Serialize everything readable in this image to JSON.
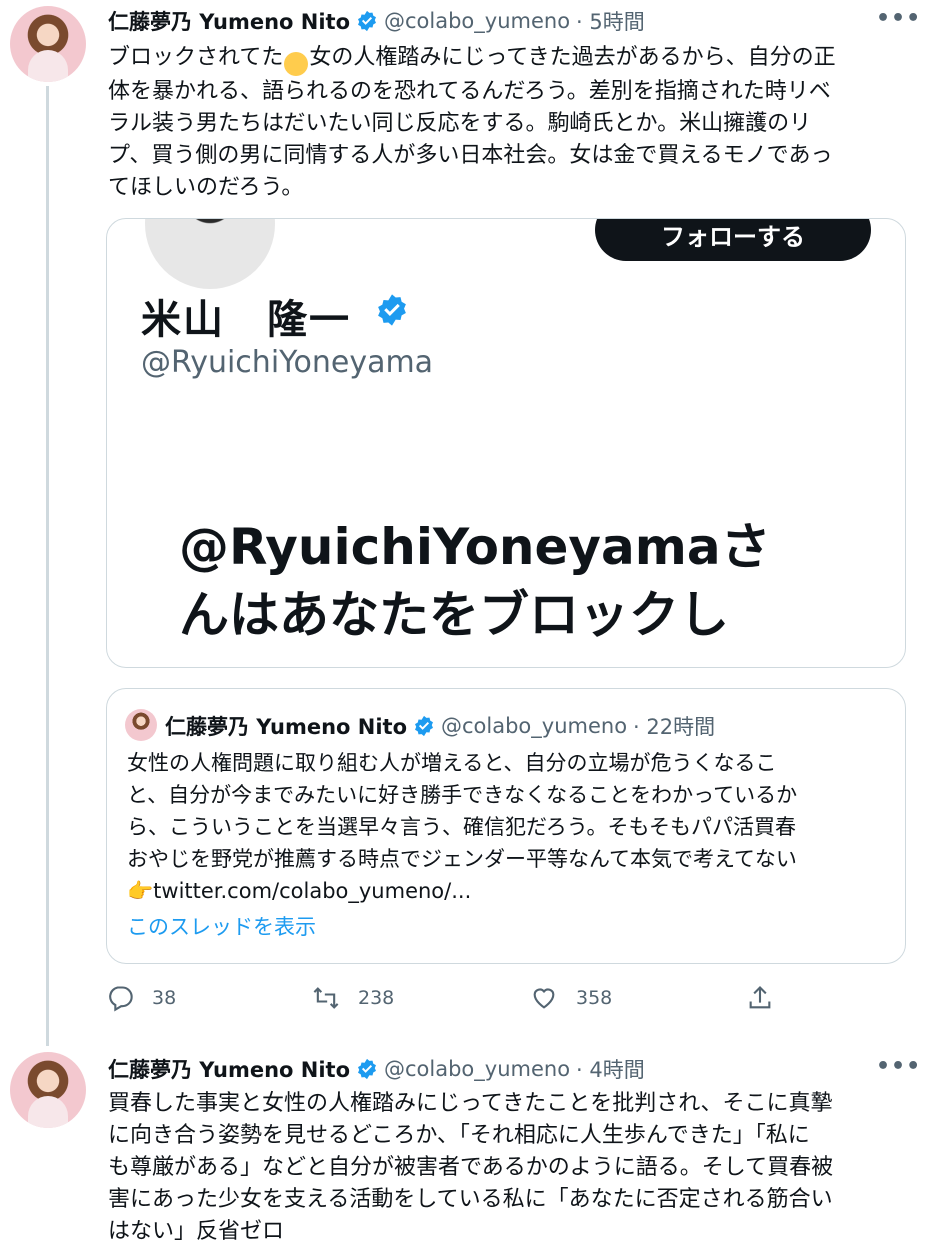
{
  "tweet1": {
    "name": "仁藤夢乃 Yumeno Nito",
    "handle": "@colabo_yumeno",
    "time": "· 5時間",
    "more": "•••",
    "text_before_emoji": "ブロックされてた",
    "emoji": "😂",
    "lines": [
      "女の人権踏みにじってきた過去があるから、自分の正",
      "体を暴かれる、語られるのを恐れてるんだろう。差別を指摘された時リベ",
      "ラル装う男たちはだいたい同じ反応をする。駒崎氏とか。米山擁護のリ",
      "プ、買う側の男に同情する人が多い日本社会。女は金で買えるモノであっ",
      "てほしいのだろう。"
    ],
    "embed": {
      "follow_label": "フォローする",
      "name": "米山　隆一",
      "handle": "@RyuichiYoneyama",
      "block_line1": "@RyuichiYoneyamaさ",
      "block_line2": "んはあなたをブロックし"
    },
    "quote": {
      "name": "仁藤夢乃 Yumeno Nito",
      "handle": "@colabo_yumeno",
      "time": "· 22時間",
      "lines": [
        "女性の人権問題に取り組む人が増えると、自分の立場が危うくなるこ",
        "と、自分が今までみたいに好き勝手できなくなることをわかっているか",
        "ら、こういうことを当選早々言う、確信犯だろう。そもそもパパ活買春",
        "おやじを野党が推薦する時点でジェンダー平等なんて本気で考えてない"
      ],
      "link_emoji": "👉",
      "link": "twitter.com/colabo_yumeno/...",
      "show_thread": "このスレッドを表示"
    },
    "actions": {
      "replies": "38",
      "retweets": "238",
      "likes": "358"
    }
  },
  "tweet2": {
    "name": "仁藤夢乃 Yumeno Nito",
    "handle": "@colabo_yumeno",
    "time": "· 4時間",
    "more": "•••",
    "lines": [
      "買春した事実と女性の人権踏みにじってきたことを批判され、そこに真摯",
      "に向き合う姿勢を見せるどころか、「それ相応に人生歩んできた」「私に",
      "も尊厳がある」などと自分が被害者であるかのように語る。そして買春被",
      "害にあった少女を支える活動をしている私に「あなたに否定される筋合い",
      "はない」反省ゼロ"
    ]
  },
  "colors": {
    "accent": "#1d9bf0",
    "muted": "#536471",
    "text": "#0f1419",
    "border": "#cfd9de"
  }
}
